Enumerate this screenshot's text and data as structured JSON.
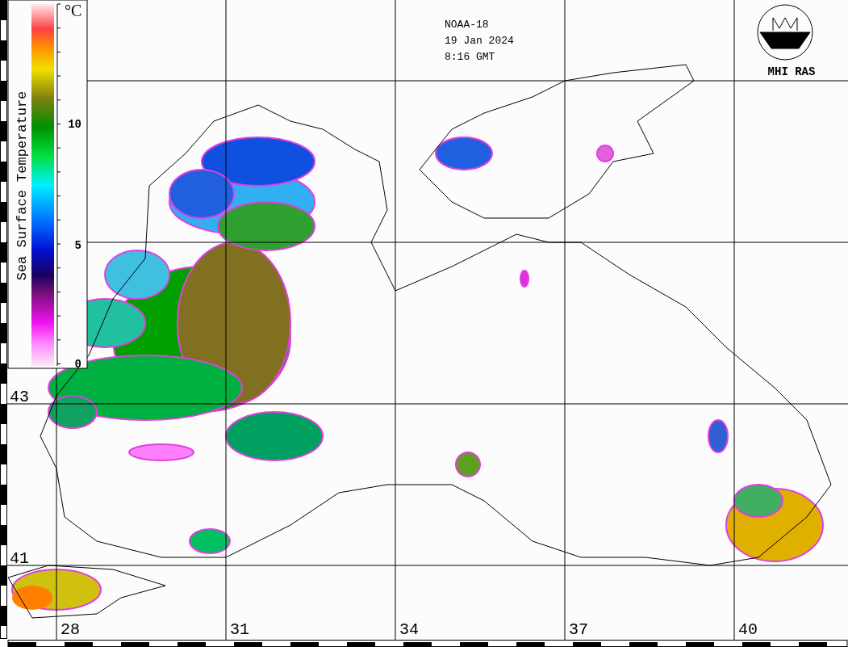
{
  "header": {
    "satellite": "NOAA-18",
    "date": "19 Jan 2024",
    "time": "8:16 GMT"
  },
  "logo": {
    "label": "MHI RAS"
  },
  "legend": {
    "title": "Sea Surface Temperature",
    "unit": "°C",
    "ticks": [
      "10",
      "5",
      "0"
    ]
  },
  "latitude_labels": [
    "43",
    "41"
  ],
  "longitude_labels": [
    "28",
    "31",
    "34",
    "37",
    "40"
  ]
}
